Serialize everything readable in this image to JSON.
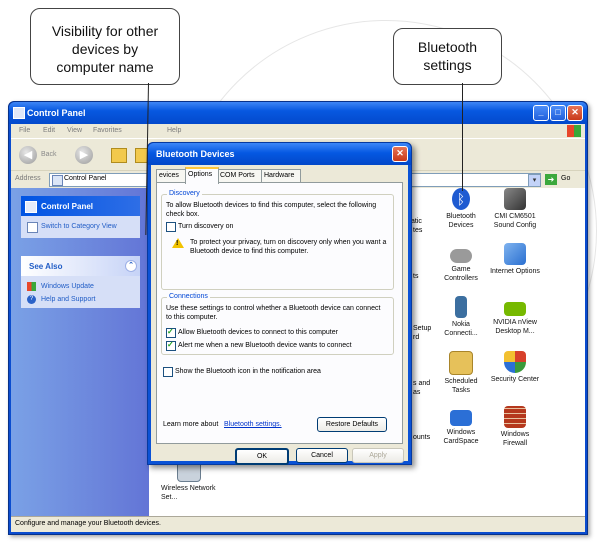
{
  "callouts": {
    "visibility": "Visibility for other devices by computer name",
    "bt_settings": "Bluetooth settings"
  },
  "window": {
    "title": "Control Panel",
    "menu": [
      "File",
      "Edit",
      "View",
      "Favorites",
      "Help"
    ],
    "back_label": "Back",
    "address_label": "Address",
    "address_value": "Control Panel",
    "go_label": "Go",
    "status": "Configure and manage your Bluetooth devices."
  },
  "left_pane": {
    "cp_header": "Control Panel",
    "switch_link": "Switch to Category View",
    "see_also_header": "See Also",
    "see_also_items": [
      "Windows Update",
      "Help and Support"
    ]
  },
  "icons": [
    {
      "label": "Bluetooth Devices",
      "color": "#1f5bd1"
    },
    {
      "label": "CMI CM6501 Sound Config",
      "color": "#5a5a5a"
    },
    {
      "label": "Game Controllers",
      "color": "#7a7a7a"
    },
    {
      "label": "Internet Options",
      "color": "#2a6fd0"
    },
    {
      "label": "Nokia Connecti...",
      "color": "#3c6fa0"
    },
    {
      "label": "NVIDIA nView Desktop M...",
      "color": "#76b900"
    },
    {
      "label": "Scheduled Tasks",
      "color": "#d8a62a"
    },
    {
      "label": "Security Center",
      "color": "#c0392b"
    },
    {
      "label": "Windows CardSpace",
      "color": "#2b6fd6"
    },
    {
      "label": "Windows Firewall",
      "color": "#b5381d"
    },
    {
      "label": "Wireless Network Set...",
      "color": "#6a7d8f"
    }
  ],
  "partial_labels": [
    "atic",
    "tes",
    "ts",
    "Setup",
    "rd",
    "s and",
    "as",
    "ounts"
  ],
  "dialog": {
    "title": "Bluetooth Devices",
    "tabs": [
      "evices",
      "Options",
      "COM Ports",
      "Hardware"
    ],
    "discovery_title": "Discovery",
    "discovery_text": "To allow Bluetooth devices to find this computer, select the following check box.",
    "turn_discovery": "Turn discovery on",
    "privacy_note": "To protect your privacy, turn on discovery only when you want a Bluetooth device to find this computer.",
    "connections_title": "Connections",
    "connections_text": "Use these settings to control whether a Bluetooth device can connect to this computer.",
    "allow_connect": "Allow Bluetooth devices to connect to this computer",
    "alert_me": "Alert me when a new Bluetooth device wants to connect",
    "show_icon": "Show the Bluetooth icon in the notification area",
    "learn_more_prefix": "Learn more about",
    "learn_more_link": "Bluetooth settings.",
    "restore_defaults": "Restore Defaults",
    "ok": "OK",
    "cancel": "Cancel",
    "apply": "Apply",
    "state": {
      "turn_discovery": false,
      "allow_connect": true,
      "alert_me": true,
      "show_icon": false
    }
  }
}
